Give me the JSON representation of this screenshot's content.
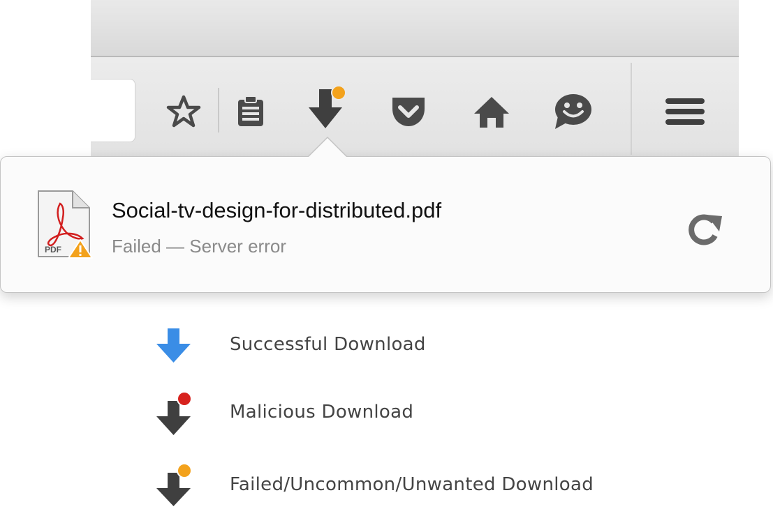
{
  "toolbar": {
    "icons": [
      "star-icon",
      "reading-list-icon",
      "download-icon",
      "pocket-icon",
      "home-icon",
      "chat-icon",
      "menu-icon"
    ],
    "download_badge_color": "#f3a21c"
  },
  "download_panel": {
    "file_name": "Social-tv-design-for-distributed.pdf",
    "file_type_label": "PDF",
    "status": "Failed — Server error",
    "file_icon": "pdf-icon",
    "warning_icon": "warning-icon",
    "retry_icon": "retry-icon"
  },
  "legend": {
    "items": [
      {
        "label": "Successful Download",
        "icon": "download-success-icon",
        "arrow_color": "#3a8de6",
        "badge_color": ""
      },
      {
        "label": "Malicious Download",
        "icon": "download-malicious-icon",
        "arrow_color": "#3f3f3f",
        "badge_color": "#d7221e"
      },
      {
        "label": "Failed/Uncommon/Unwanted Download",
        "icon": "download-failed-icon",
        "arrow_color": "#3f3f3f",
        "badge_color": "#f3a21c"
      }
    ]
  },
  "colors": {
    "icon_gray": "#4a4a4a",
    "accent_blue": "#3a8de6",
    "danger_red": "#d7221e",
    "warning_orange": "#f3a21c"
  }
}
